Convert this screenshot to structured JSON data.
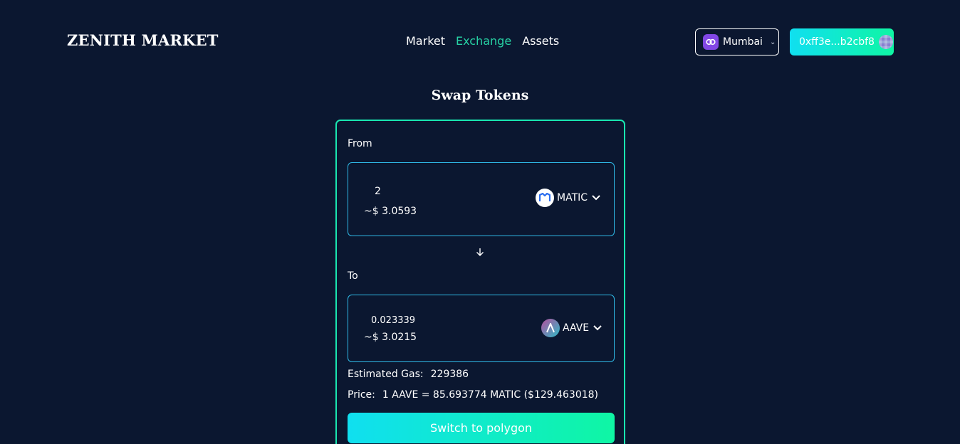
{
  "brand": "ZENITH MARKET",
  "nav": {
    "items": [
      "Market",
      "Exchange",
      "Assets"
    ],
    "active": "Exchange"
  },
  "network": {
    "label": "Mumbai",
    "icon": "polygon-icon"
  },
  "wallet": {
    "address": "0xff3e...b2cbf8"
  },
  "swap": {
    "title": "Swap Tokens",
    "from": {
      "label": "From",
      "amount": "2",
      "usd": "~$ 3.0593",
      "token": "MATIC"
    },
    "to": {
      "label": "To",
      "amount": "0.023339",
      "usd": "~$ 3.0215",
      "token": "AAVE"
    },
    "gas": {
      "label": "Estimated Gas:",
      "value": "229386"
    },
    "price": {
      "label": "Price:",
      "value": "1 AAVE = 85.693774 MATIC ($129.463018)"
    },
    "button_label": "Switch to polygon"
  },
  "colors": {
    "background": "#0b1730",
    "accent": "#27d3a5",
    "gradient_start": "#10dff0",
    "gradient_end": "#0ff6a4"
  }
}
